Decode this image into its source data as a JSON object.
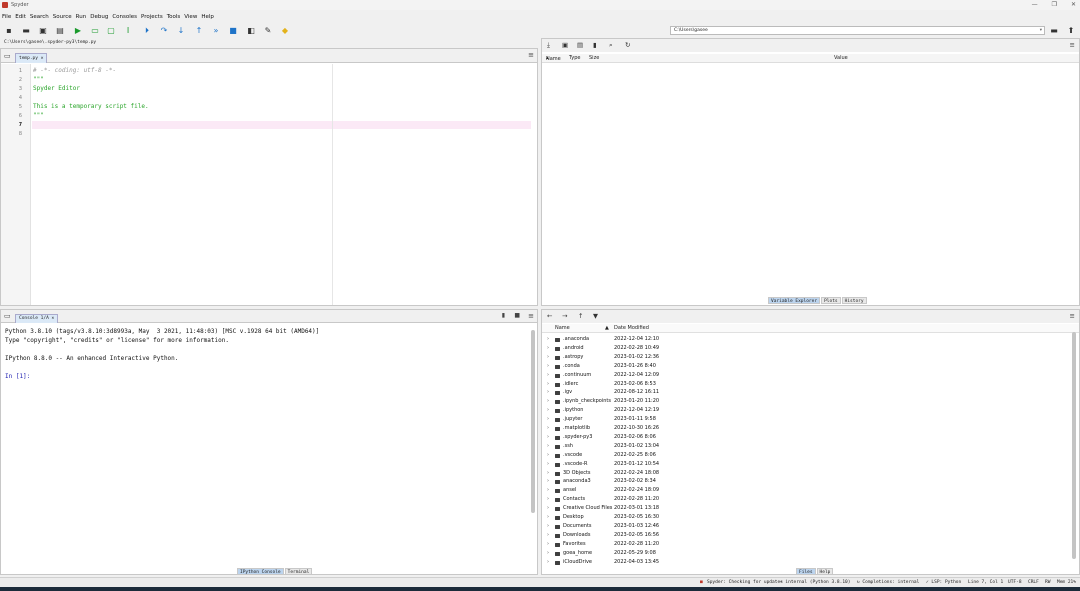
{
  "window": {
    "title": "Spyder",
    "controls": [
      "—",
      "❐",
      "✕"
    ]
  },
  "menu": [
    "File",
    "Edit",
    "Search",
    "Source",
    "Run",
    "Debug",
    "Consoles",
    "Projects",
    "Tools",
    "View",
    "Help"
  ],
  "toolbar": {
    "icons": [
      "new-file",
      "open-folder",
      "save",
      "save-all",
      "run",
      "run-cell",
      "run-cell-advance",
      "run-selection",
      "debug",
      "step",
      "step-into",
      "step-return",
      "continue",
      "stop",
      "maximize-pane",
      "preferences",
      "python-path"
    ],
    "working_dir": "C:\\Users\\gasee"
  },
  "editor": {
    "file_path": "C:\\Users\\gasee\\.spyder-py3\\temp.py",
    "tab_label": "temp.py",
    "lines": [
      {
        "num": "1",
        "text": "# -*- coding: utf-8 -*-",
        "kind": "comment"
      },
      {
        "num": "2",
        "text": "\"\"\"",
        "kind": "str"
      },
      {
        "num": "3",
        "text": "Spyder Editor",
        "kind": "str"
      },
      {
        "num": "4",
        "text": "",
        "kind": "str"
      },
      {
        "num": "5",
        "text": "This is a temporary script file.",
        "kind": "str"
      },
      {
        "num": "6",
        "text": "\"\"\"",
        "kind": "str"
      },
      {
        "num": "7",
        "text": "",
        "kind": "plain"
      },
      {
        "num": "8",
        "text": "",
        "kind": "plain"
      }
    ],
    "current_line": "7"
  },
  "variable_explorer": {
    "columns": [
      "Name",
      "Type",
      "Size",
      "Value"
    ],
    "tabs": [
      "Variable Explorer",
      "Plots",
      "History"
    ],
    "active_tab": "Variable Explorer"
  },
  "console": {
    "tab_label": "Console 1/A",
    "lines": [
      "Python 3.8.10 (tags/v3.8.10:3d8993a, May  3 2021, 11:48:03) [MSC v.1928 64 bit (AMD64)]",
      "Type \"copyright\", \"credits\" or \"license\" for more information.",
      "",
      "IPython 8.8.0 -- An enhanced Interactive Python.",
      "",
      "In [1]:"
    ],
    "tabs": [
      "IPython Console",
      "Terminal"
    ],
    "active_tab": "IPython Console"
  },
  "files": {
    "columns": [
      "Name",
      "Date Modified"
    ],
    "rows": [
      {
        "name": ".anaconda",
        "date": "2022-12-04 12:10"
      },
      {
        "name": ".android",
        "date": "2022-02-28 10:49"
      },
      {
        "name": ".astropy",
        "date": "2023-01-02 12:36"
      },
      {
        "name": ".conda",
        "date": "2023-01-26 8:40"
      },
      {
        "name": ".continuum",
        "date": "2022-12-04 12:09"
      },
      {
        "name": ".idlerc",
        "date": "2023-02-06 8:53"
      },
      {
        "name": ".igv",
        "date": "2022-08-12 16:11"
      },
      {
        "name": ".ipynb_checkpoints",
        "date": "2023-01-20 11:20"
      },
      {
        "name": ".ipython",
        "date": "2022-12-04 12:19"
      },
      {
        "name": ".jupyter",
        "date": "2023-01-11 9:58"
      },
      {
        "name": ".matplotlib",
        "date": "2022-10-30 16:26"
      },
      {
        "name": ".spyder-py3",
        "date": "2023-02-06 8:06"
      },
      {
        "name": ".ssh",
        "date": "2023-01-02 13:04"
      },
      {
        "name": ".vscode",
        "date": "2022-02-25 8:06"
      },
      {
        "name": ".vscode-R",
        "date": "2023-01-12 10:54"
      },
      {
        "name": "3D Objects",
        "date": "2022-02-24 18:08"
      },
      {
        "name": "anaconda3",
        "date": "2023-02-02 8:34"
      },
      {
        "name": "ansel",
        "date": "2022-02-24 18:09"
      },
      {
        "name": "Contacts",
        "date": "2022-02-28 11:20"
      },
      {
        "name": "Creative Cloud Files",
        "date": "2022-03-01 13:18"
      },
      {
        "name": "Desktop",
        "date": "2023-02-05 16:30"
      },
      {
        "name": "Documents",
        "date": "2023-01-03 12:46"
      },
      {
        "name": "Downloads",
        "date": "2023-02-05 16:56"
      },
      {
        "name": "Favorites",
        "date": "2022-02-28 11:20"
      },
      {
        "name": "goea_home",
        "date": "2022-05-29 9:08"
      },
      {
        "name": "iCloudDrive",
        "date": "2022-04-03 13:45"
      }
    ],
    "tabs": [
      "Files",
      "Help"
    ],
    "active_tab": "Files"
  },
  "status": {
    "updates": "Spyder: Checking for updates",
    "interpreter": "internal (Python 3.8.10)",
    "completions": "Completions: internal",
    "lsp": "LSP: Python",
    "position": "Line 7, Col 1",
    "encoding": "UTF-8",
    "eol": "CRLF",
    "rw": "RW",
    "mem": "Mem 21%"
  },
  "colors": {
    "comment": "#9a9a9a",
    "string": "#2aa52a",
    "current_line": "#fbe9f6",
    "prompt": "#1b1bb0",
    "accent": "#1e73c8"
  }
}
